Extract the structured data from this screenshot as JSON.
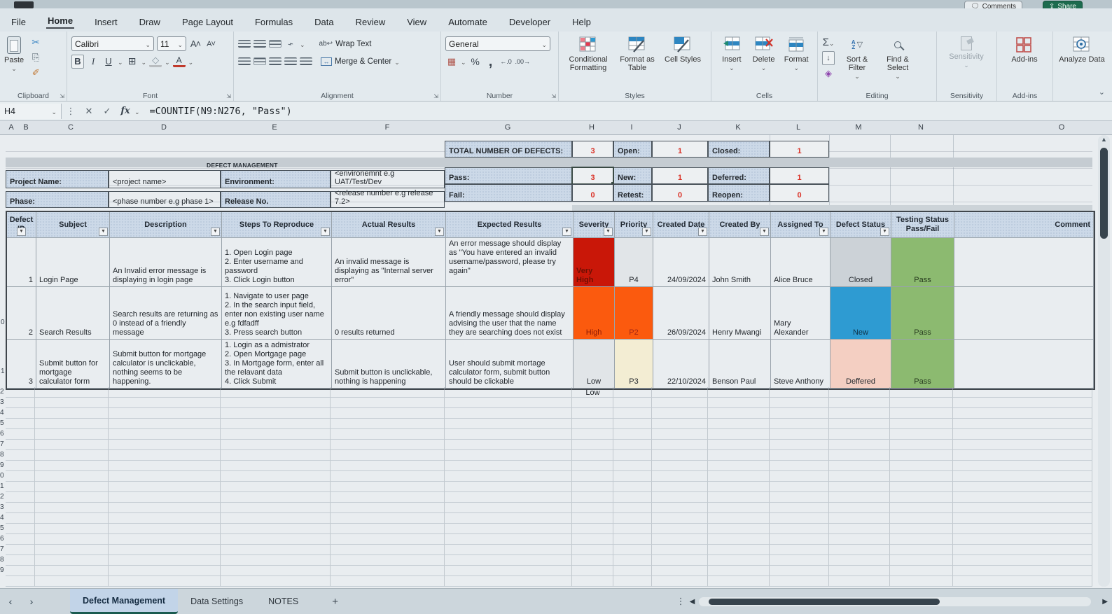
{
  "window": {
    "comments": "Comments",
    "share": "Share"
  },
  "ribbon": {
    "tabs": [
      "File",
      "Home",
      "Insert",
      "Draw",
      "Page Layout",
      "Formulas",
      "Data",
      "Review",
      "View",
      "Automate",
      "Developer",
      "Help"
    ],
    "active_tab": "Home",
    "clipboard": {
      "paste": "Paste",
      "label": "Clipboard"
    },
    "font": {
      "family": "Calibri",
      "size": "11",
      "label": "Font"
    },
    "alignment": {
      "wrap": "Wrap Text",
      "merge": "Merge & Center",
      "label": "Alignment"
    },
    "number": {
      "format": "General",
      "label": "Number"
    },
    "styles": {
      "conditional": "Conditional Formatting",
      "format_table": "Format as Table",
      "cell_styles": "Cell Styles",
      "label": "Styles"
    },
    "cells": {
      "insert": "Insert",
      "delete": "Delete",
      "format": "Format",
      "label": "Cells"
    },
    "editing": {
      "sort": "Sort & Filter",
      "find": "Find & Select",
      "label": "Editing"
    },
    "sensitivity": {
      "button": "Sensitivity",
      "label": "Sensitivity"
    },
    "addins": {
      "button": "Add-ins",
      "label": "Add-ins"
    },
    "analyze": {
      "button": "Analyze Data"
    }
  },
  "formula_bar": {
    "name_box": "H4",
    "formula": "=COUNTIF(N9:N276, \"Pass\")"
  },
  "sheet": {
    "columns": [
      "A",
      "B",
      "C",
      "D",
      "E",
      "F",
      "G",
      "H",
      "I",
      "J",
      "K",
      "L",
      "M",
      "N",
      "O"
    ],
    "summary": {
      "r1": {
        "l1": "TOTAL NUMBER OF DEFECTS:",
        "v1": "3",
        "l2": "Open:",
        "v2": "1",
        "l3": "Closed:",
        "v3": "1"
      },
      "r2": {
        "l1": "Pass:",
        "v1": "3",
        "l2": "New:",
        "v2": "1",
        "l3": "Deferred:",
        "v3": "1"
      },
      "r3": {
        "l1": "Fail:",
        "v1": "0",
        "l2": "Retest:",
        "v2": "0",
        "l3": "Reopen:",
        "v3": "0"
      }
    },
    "info": {
      "title": "DEFECT MANAGEMENT",
      "r1": {
        "l1": "Project Name:",
        "v1": "<project name>",
        "l2": "Environment:",
        "v2": "<environemnt e.g UAT/Test/Dev"
      },
      "r2": {
        "l1": "Phase:",
        "v1": "<phase number e.g phase 1>",
        "l2": "Release No.",
        "v2": "<release number e.g release 7.2>"
      }
    },
    "table": {
      "headers": [
        "Defect ID",
        "Subject",
        "Description",
        "Steps To Reproduce",
        "Actual Results",
        "Expected Results",
        "Severity",
        "Priority",
        "Created Date",
        "Created By",
        "Assigned To",
        "Defect Status",
        "Testing Status\nPass/Fail",
        "Comment"
      ],
      "defects": [
        {
          "id": "1",
          "subject": "Login Page",
          "description": "An Invalid error message is displaying in login page",
          "steps": "1. Open Login page\n2. Enter username and password\n3. Click Login button",
          "actual": "An invalid message is displaying as \"Internal server error\"",
          "expected": "An error message should display as \"You have entered an invalid username/password, please try again\"",
          "severity": "Very High",
          "priority": "P4",
          "created_date": "24/09/2024",
          "created_by": "John Smith",
          "assigned_to": "Alice Bruce",
          "status": "Closed",
          "testing": "Pass"
        },
        {
          "id": "2",
          "subject": "Search Results",
          "description": "Search results are returning as 0 instead of a friendly message",
          "steps": "1. Navigate to user page\n2. In the search input field, enter non existing user name e.g fdfadff\n3. Press search button",
          "actual": "0 results returned",
          "expected": "A friendly message should display advising the user that the name they are searching does not exist",
          "severity": "High",
          "priority": "P2",
          "created_date": "26/09/2024",
          "created_by": "Henry Mwangi",
          "assigned_to": "Mary Alexander",
          "status": "New",
          "testing": "Pass"
        },
        {
          "id": "3",
          "subject": "Submit button for mortgage calculator form",
          "description": "Submit button for mortgage calculator is unclickable, nothing seems to be happening.",
          "steps": "1. Login as a admistrator\n2. Open Mortgage page\n3. In Mortgage form, enter all the relavant data\n4. Click Submit",
          "actual": "Submit button is unclickable, nothing is happening",
          "expected": "User should submit mortage calculator form, submit button should be clickable",
          "severity": "Low",
          "priority": "P3",
          "created_date": "22/10/2024",
          "created_by": "Benson Paul",
          "assigned_to": "Steve Anthony",
          "status": "Deffered",
          "testing": "Pass"
        }
      ],
      "extra_severity": "Low"
    },
    "row_stub_data": {
      "row2": "0",
      "row3": "1"
    },
    "row_stubs": [
      "2",
      "3",
      "4",
      "5",
      "6",
      "7",
      "8",
      "9",
      "0",
      "1",
      "2",
      "3",
      "4",
      "5",
      "6",
      "7",
      "8",
      "9",
      ""
    ],
    "tabs": {
      "items": [
        "Defect Management",
        "Data Settings",
        "NOTES"
      ],
      "active": "Defect Management",
      "add": "+"
    }
  },
  "colors": {
    "severity_very_high": "#c91708",
    "severity_high": "#fb5a0e",
    "priority_p2": "#fb5a0e",
    "priority_p3": "#f3edd3",
    "status_new": "#2e9bd2",
    "status_closed": "#ccd2d7",
    "status_deffered": "#f4cfc2",
    "testing_pass": "#8cba70",
    "summary_value_red": "#da3025",
    "header_fill": "#ccd9e8",
    "share_green": "#1d6b4e",
    "active_tab_underline": "#1a5b4f"
  }
}
